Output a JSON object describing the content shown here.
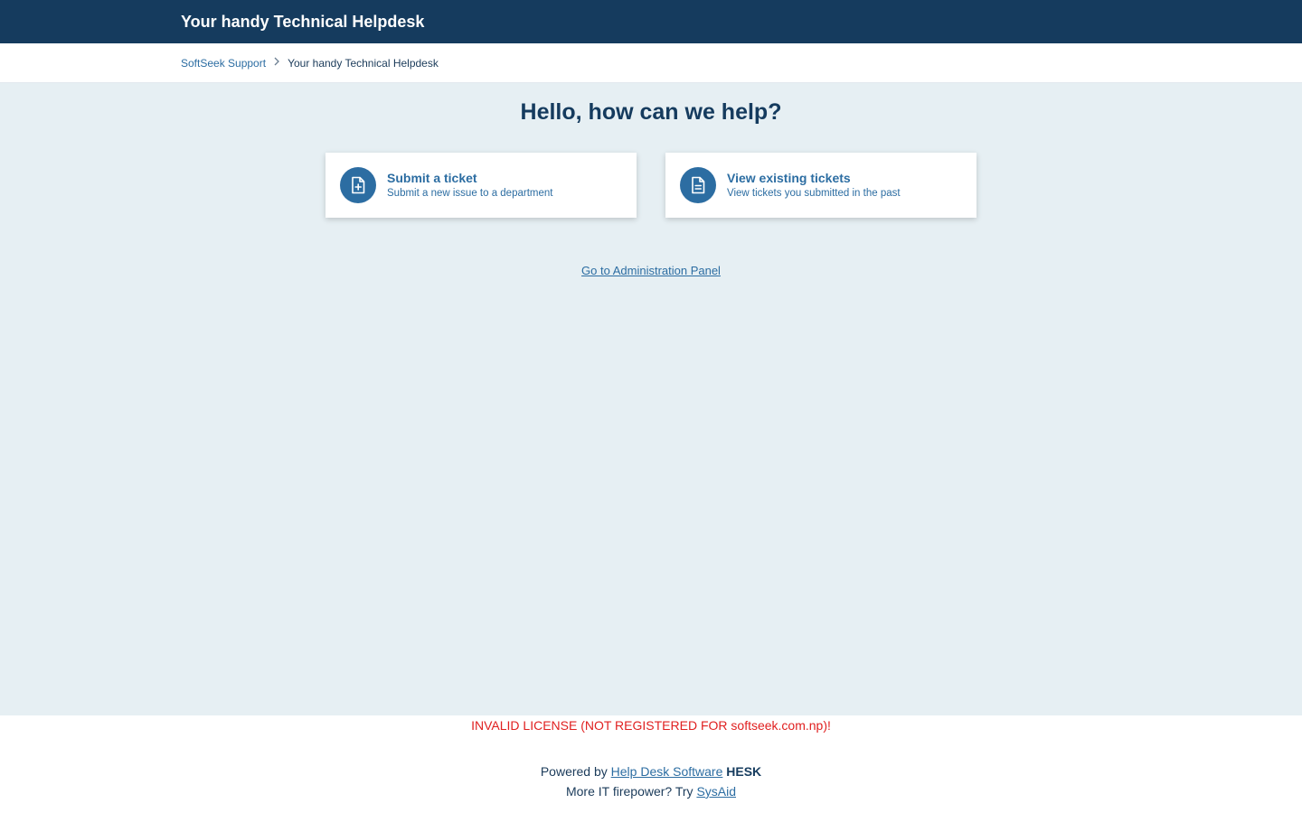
{
  "header": {
    "title": "Your handy Technical Helpdesk"
  },
  "breadcrumb": {
    "items": [
      {
        "label": "SoftSeek Support"
      },
      {
        "label": "Your handy Technical Helpdesk"
      }
    ],
    "separator_icon": "chevron-right-icon"
  },
  "main": {
    "headline": "Hello, how can we help?",
    "cards": [
      {
        "title": "Submit a ticket",
        "subtitle": "Submit a new issue to a department",
        "icon": "file-plus-icon"
      },
      {
        "title": "View existing tickets",
        "subtitle": "View tickets you submitted in the past",
        "icon": "file-text-icon"
      }
    ],
    "admin_link": "Go to Administration Panel"
  },
  "footer": {
    "license_warning": "INVALID LICENSE (NOT REGISTERED FOR softseek.com.np)!",
    "powered_by_prefix": "Powered by",
    "powered_by_link": "Help Desk Software",
    "powered_by_brand": "HESK",
    "more_prefix": "More IT firepower? Try",
    "more_link": "SysAid"
  },
  "colors": {
    "header_bg": "#153b5e",
    "accent": "#2c6da2",
    "main_bg": "#e6eff3",
    "warning": "#e02020"
  }
}
